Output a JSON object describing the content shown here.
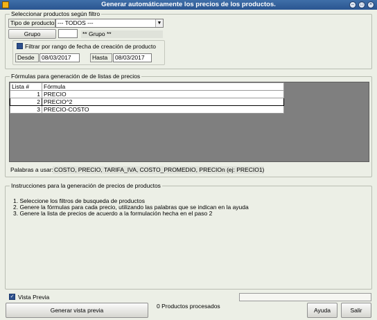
{
  "window": {
    "title": "Generar automáticamente los precios de los productos."
  },
  "filter": {
    "legend": "Seleccionar productos según filtro",
    "product_type_label": "Tipo de producto",
    "product_type_value": "--- TODOS ---",
    "group_button": "Grupo",
    "group_code": "",
    "group_name": "** Grupo **",
    "date_checkbox_label": "Filtrar por rango de fecha de creación de producto",
    "from_label": "Desde",
    "from_value": "08/03/2017",
    "to_label": "Hasta",
    "to_value": "08/03/2017"
  },
  "formulas": {
    "legend": "Fórmulas para generación de de listas de precios",
    "columns": [
      "Lista #",
      "Fórmula"
    ],
    "rows": [
      {
        "list": "1",
        "formula": "PRECIO"
      },
      {
        "list": "2",
        "formula": "PRECIO^2"
      },
      {
        "list": "3",
        "formula": "PRECIO-COSTO"
      }
    ],
    "keywords_label": "Palabras a usar:",
    "keywords_value": "COSTO, PRECIO, TARIFA_IVA, COSTO_PROMEDIO, PRECIOn (ej: PRECIO1)"
  },
  "instructions": {
    "legend": "Instrucciones para la generación de precios de productos",
    "lines": [
      "1. Seleccione los filtros de busqueda de productos",
      "2. Genere la fórmulas para cada precio, utilizando las palabras que se indican en la ayuda",
      "3. Genere la lista de precios de acuerdo a la formulación hecha en el paso 2"
    ]
  },
  "footer": {
    "preview_checkbox_label": "Vista Previa",
    "preview_checked": true,
    "generate_button": "Generar vista previa",
    "processed_status": "0 Productos procesados",
    "help_button": "Ayuda",
    "exit_button": "Salir"
  }
}
